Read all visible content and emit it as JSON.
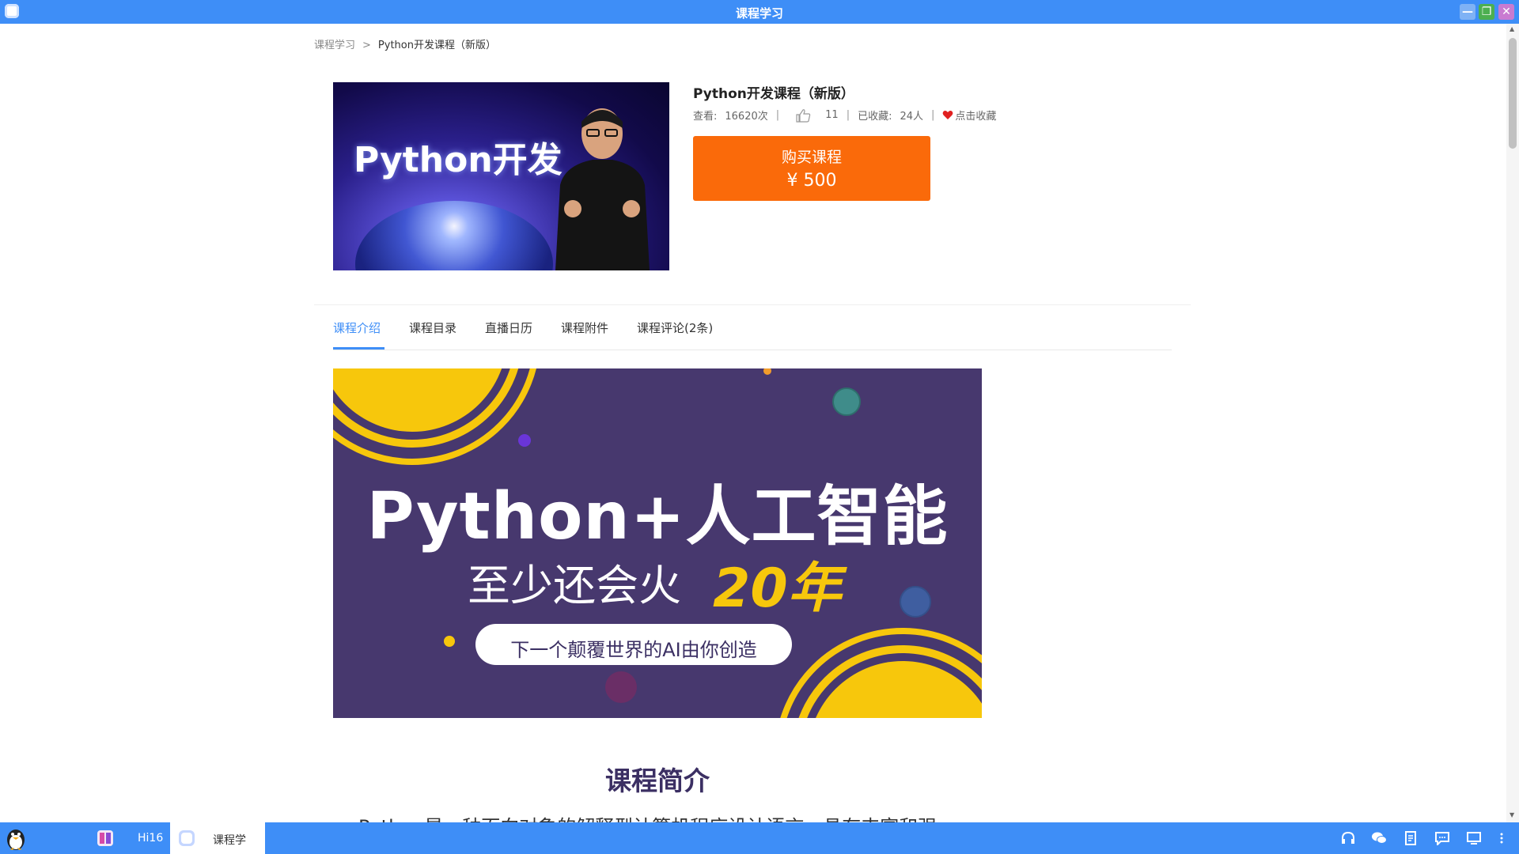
{
  "window": {
    "title": "课程学习"
  },
  "breadcrumb": {
    "root": "课程学习",
    "separator": ">",
    "current": "Python开发课程（新版）"
  },
  "course": {
    "title": "Python开发课程（新版）",
    "cover_text": "Python开发",
    "views_label": "查看:",
    "views_value": "16620次",
    "likes": "11",
    "favorites_label": "已收藏:",
    "favorites_value": "24人",
    "favorite_action": "点击收藏",
    "buy_label": "购买课程",
    "price": "¥ 500"
  },
  "tabs": [
    {
      "label": "课程介绍",
      "active": true
    },
    {
      "label": "课程目录"
    },
    {
      "label": "直播日历"
    },
    {
      "label": "课程附件"
    },
    {
      "label": "课程评论(2条)"
    }
  ],
  "banner": {
    "headline": "Python+人工智能",
    "subline": "至少还会火",
    "highlight": "20年",
    "pill": "下一个颠覆世界的AI由你创造"
  },
  "intro": {
    "title": "课程简介",
    "first_line": "Python是一种面向对象的解释型计算机程序设计语言，具有丰富和强"
  },
  "taskbar": {
    "tasks": [
      {
        "label": "Hi16"
      },
      {
        "label": "课程学"
      }
    ],
    "tray_icons": [
      "headset-icon",
      "wechat-icon",
      "document-icon",
      "chat-icon",
      "monitor-icon",
      "more-icon"
    ]
  },
  "colors": {
    "accent": "#3e8ef7",
    "buy": "#fa6a0a",
    "banner_bg": "#47386e",
    "banner_yellow": "#f7c70c"
  }
}
